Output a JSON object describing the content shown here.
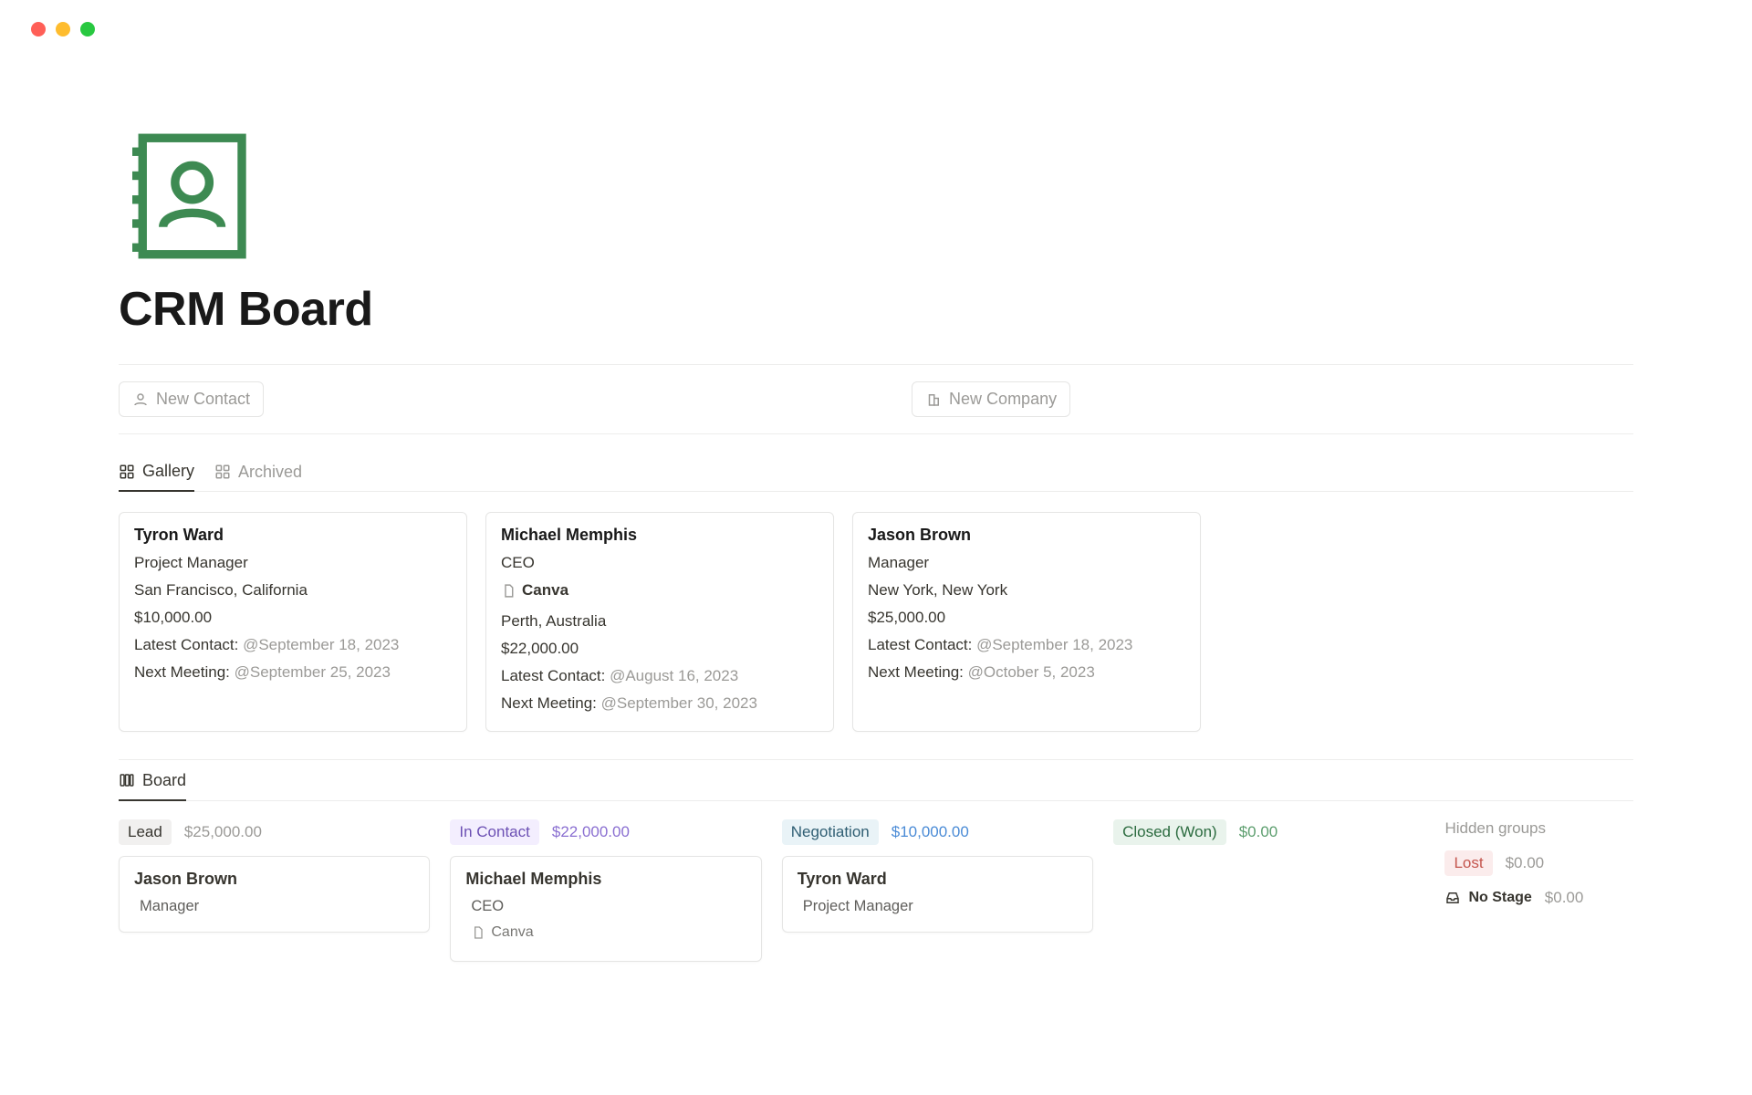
{
  "page": {
    "title": "CRM Board"
  },
  "actions": {
    "new_contact": "New Contact",
    "new_company": "New Company"
  },
  "gallery_tabs": {
    "gallery": "Gallery",
    "archived": "Archived"
  },
  "labels": {
    "latest_contact": "Latest Contact:",
    "next_meeting": "Next Meeting:"
  },
  "contacts": [
    {
      "name": "Tyron Ward",
      "role": "Project Manager",
      "company": null,
      "location": "San Francisco, California",
      "amount": "$10,000.00",
      "latest_contact": "@September 18, 2023",
      "next_meeting": "@September 25, 2023"
    },
    {
      "name": "Michael Memphis",
      "role": "CEO",
      "company": "Canva",
      "location": "Perth, Australia",
      "amount": "$22,000.00",
      "latest_contact": "@August 16, 2023",
      "next_meeting": "@September 30, 2023"
    },
    {
      "name": "Jason Brown",
      "role": "Manager",
      "company": null,
      "location": "New York, New York",
      "amount": "$25,000.00",
      "latest_contact": "@September 18, 2023",
      "next_meeting": "@October 5, 2023"
    }
  ],
  "board_tab": "Board",
  "board": {
    "columns": [
      {
        "stage": "Lead",
        "pill_class": "pill-lead",
        "amount": "$25,000.00",
        "amount_class": "",
        "card": {
          "name": "Jason Brown",
          "role": "Manager",
          "company": null
        }
      },
      {
        "stage": "In Contact",
        "pill_class": "pill-contact",
        "amount": "$22,000.00",
        "amount_class": "purple",
        "card": {
          "name": "Michael Memphis",
          "role": "CEO",
          "company": "Canva"
        }
      },
      {
        "stage": "Negotiation",
        "pill_class": "pill-negot",
        "amount": "$10,000.00",
        "amount_class": "blue",
        "card": {
          "name": "Tyron Ward",
          "role": "Project Manager",
          "company": null
        }
      },
      {
        "stage": "Closed (Won)",
        "pill_class": "pill-won",
        "amount": "$0.00",
        "amount_class": "green",
        "card": null
      }
    ],
    "hidden": {
      "title": "Hidden groups",
      "rows": [
        {
          "label": "Lost",
          "kind": "pill",
          "pill_class": "pill-lost",
          "amount": "$0.00"
        },
        {
          "label": "No Stage",
          "kind": "nostage",
          "amount": "$0.00"
        }
      ]
    }
  }
}
